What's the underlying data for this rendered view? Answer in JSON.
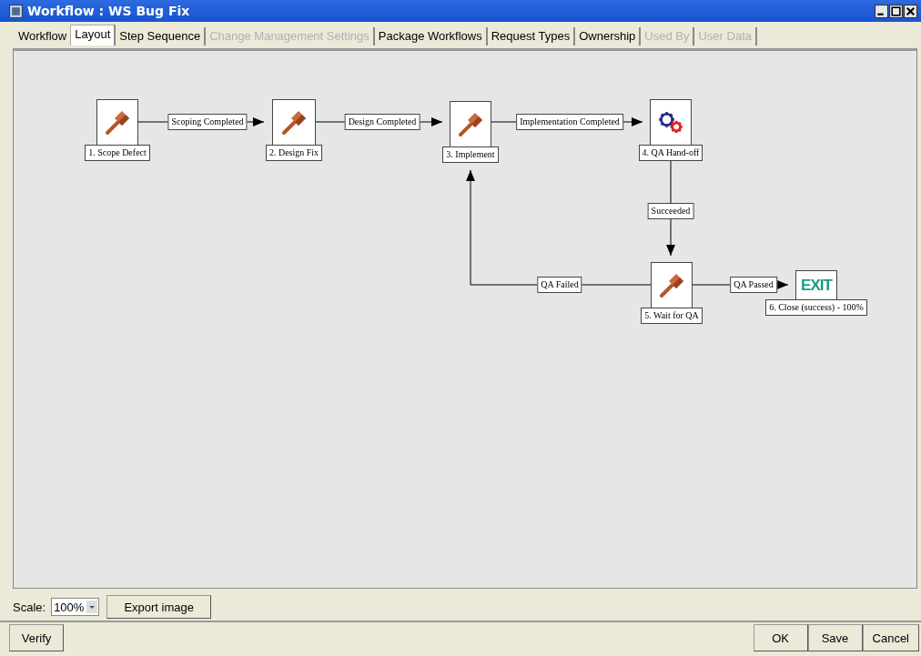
{
  "window": {
    "title": "Workflow : WS Bug Fix"
  },
  "tabs": [
    {
      "label": "Workflow",
      "selected": false,
      "disabled": false
    },
    {
      "label": "Layout",
      "selected": true,
      "disabled": false
    },
    {
      "label": "Step Sequence",
      "selected": false,
      "disabled": false
    },
    {
      "label": "Change Management Settings",
      "selected": false,
      "disabled": true
    },
    {
      "label": "Package Workflows",
      "selected": false,
      "disabled": false
    },
    {
      "label": "Request Types",
      "selected": false,
      "disabled": false
    },
    {
      "label": "Ownership",
      "selected": false,
      "disabled": false
    },
    {
      "label": "Used By",
      "selected": false,
      "disabled": true
    },
    {
      "label": "User Data",
      "selected": false,
      "disabled": true
    }
  ],
  "steps": [
    {
      "label": "1. Scope Defect",
      "kind": "hammer"
    },
    {
      "label": "2. Design Fix",
      "kind": "hammer"
    },
    {
      "label": "3. Implement",
      "kind": "hammer"
    },
    {
      "label": "4. QA Hand-off",
      "kind": "gears"
    },
    {
      "label": "5. Wait for QA",
      "kind": "hammer"
    },
    {
      "label": "6. Close (success) - 100%",
      "kind": "exit",
      "icon_text": "EXIT"
    }
  ],
  "transitions": [
    {
      "label": "Scoping Completed"
    },
    {
      "label": "Design Completed"
    },
    {
      "label": "Implementation Completed"
    },
    {
      "label": "Succeeded"
    },
    {
      "label": "QA Failed"
    },
    {
      "label": "QA Passed"
    }
  ],
  "scale": {
    "label": "Scale:",
    "value": "100%"
  },
  "export_button": "Export image",
  "left_buttons": [
    "Verify"
  ],
  "right_buttons": [
    "OK",
    "Save",
    "Cancel"
  ]
}
